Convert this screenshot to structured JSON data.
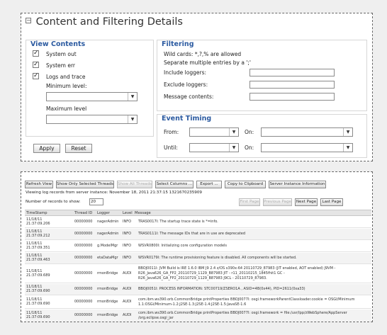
{
  "filter_panel": {
    "title": "Content and Filtering Details",
    "view_contents": {
      "title": "View Contents",
      "system_out": "System out",
      "system_err": "System err",
      "logs_and_trace": "Logs and trace",
      "min_level_label": "Minimum level:",
      "max_level_label": "Maximum level",
      "min_level_value": "",
      "max_level_value": ""
    },
    "filtering": {
      "title": "Filtering",
      "wildcards": "Wild cards: *,?,% are allowed",
      "separate": "Separate multiple entries by a ';'",
      "include_label": "Include loggers:",
      "exclude_label": "Exclude loggers:",
      "message_label": "Message contents:"
    },
    "event_timing": {
      "title": "Event Timing",
      "from_label": "From:",
      "until_label": "Until:",
      "on_label": "On:"
    },
    "apply_label": "Apply",
    "reset_label": "Reset"
  },
  "log_panel": {
    "toolbar": [
      "Refresh View",
      "Show Only Selected Threads",
      "Show All Threads",
      "Select Columns ...",
      "Export ...",
      "Copy to Clipboard",
      "Server Instance Information"
    ],
    "info": "Viewing log records from server instance: November 18, 2011 21:37:15 1321670235909",
    "records_label": "Number of records to show:",
    "records_value": "20",
    "pager": [
      "First Page",
      "Previous Page",
      "Next Page",
      "Last Page"
    ],
    "columns": [
      "TimeStamp",
      "Thread ID",
      "Logger",
      "Level",
      "Message"
    ],
    "rows": [
      {
        "ts1": "11/18/11",
        "ts2": "21:37:09.206",
        "thread": "00000000",
        "logger": "nagerAdmin",
        "level": "INFO",
        "link": "TRAS0017I",
        "msg": ": The startup trace state is *=info."
      },
      {
        "ts1": "11/18/11",
        "ts2": "21:37:09.212",
        "thread": "00000000",
        "logger": "nagerAdmin",
        "level": "INFO",
        "link": "TRAS0111I",
        "msg": ": The message IDs that are in use are deprecated"
      },
      {
        "ts1": "11/18/11",
        "ts2": "21:37:09.351",
        "thread": "00000000",
        "logger": "g.ModelMgr",
        "level": "INFO",
        "link": "WSVR0800I",
        "msg": ": Initializing core configuration models"
      },
      {
        "ts1": "11/18/11",
        "ts2": "21:37:09.463",
        "thread": "00000000",
        "logger": "etaDataMgr",
        "level": "INFO",
        "link": "WSVR0179I",
        "msg": ": The runtime provisioning feature is disabled. All components will be started."
      },
      {
        "ts1": "11/18/11",
        "ts2": "21:37:09.689",
        "thread": "00000000",
        "logger": "rmonBridge",
        "level": "AUDI",
        "link": "BBOJ0011I",
        "msg": ": JVM Build is IRE 1.6.0 IBM J9 2.4 z/OS s390x-64 20110729_87983 (JIT enabled, AOT enabled) J9VM -",
        "msg2": "R26_Java626_GA_FP2_20110729_1129_B87983 JIT - r11_20110215_1845fhit1 GC -",
        "msg3": "R26_Java626_GA_FP2_20110729_1129_B87983 J9CL - 20110729_87983."
      },
      {
        "ts1": "11/18/11",
        "ts2": "21:37:09.690",
        "thread": "00000000",
        "logger": "rmonBridge",
        "level": "AUDI",
        "link": "BBOJ0051I",
        "msg": ": PROCESS INFORMATION: STC00719/ZSERO1A , ASID=4B(0x44), PID=2611(0xa33)"
      },
      {
        "ts1": "11/18/11",
        "ts2": "21:37:09.690",
        "thread": "00000000",
        "logger": "rmonBridge",
        "level": "AUDI",
        "pre": "com.ibm.ws390.orb.CommonBridge printProperties ",
        "link": "BBOJ0077I",
        "msg": ": osgi.frameworkParentClassloader.cookie = OSGI/Minimum",
        "msg2": "1.1:OSGi/Minimum-1.2:J2SE-1.3:J2SE-1.4:J2SE-1.5:JavaSE-1.6"
      },
      {
        "ts1": "11/18/11",
        "ts2": "21:37:09.690",
        "thread": "00000000",
        "logger": "rmonBridge",
        "level": "AUDI",
        "pre": "com.ibm.ws390.orb.CommonBridge printProperties ",
        "link": "BBOJ0077I",
        "msg": ": osgi.framework = file:/usr/lpp/zWebSphere/AppServer",
        "msg2": "/org.eclipse.osgi_jar"
      }
    ]
  }
}
